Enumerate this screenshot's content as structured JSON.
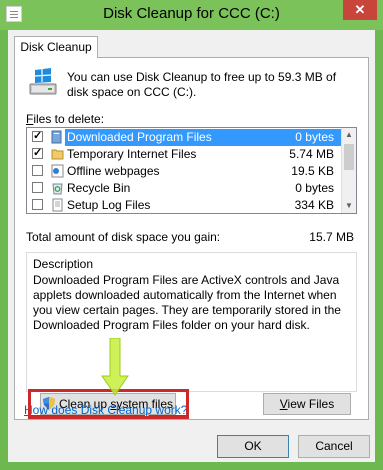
{
  "window": {
    "title": "Disk Cleanup for CCC (C:)",
    "close_glyph": "✕"
  },
  "tab": {
    "label": "Disk Cleanup"
  },
  "intro": {
    "text": "You can use Disk Cleanup to free up to 59.3 MB of disk space on CCC (C:)."
  },
  "files": {
    "label_accel": "F",
    "label_rest": "iles to delete:",
    "items": [
      {
        "checked": true,
        "name": "Downloaded Program Files",
        "size": "0 bytes",
        "icon": "folder-icon",
        "selected": true
      },
      {
        "checked": true,
        "name": "Temporary Internet Files",
        "size": "5.74 MB",
        "icon": "folder-icon"
      },
      {
        "checked": false,
        "name": "Offline webpages",
        "size": "19.5 KB",
        "icon": "webpage-icon"
      },
      {
        "checked": false,
        "name": "Recycle Bin",
        "size": "0 bytes",
        "icon": "recycle-bin-icon"
      },
      {
        "checked": false,
        "name": "Setup Log Files",
        "size": "334 KB",
        "icon": "document-icon"
      }
    ]
  },
  "total": {
    "label": "Total amount of disk space you gain:",
    "value": "15.7 MB"
  },
  "description": {
    "title": "Description",
    "text": "Downloaded Program Files are ActiveX controls and Java applets downloaded automatically from the Internet when you view certain pages. They are temporarily stored in the Downloaded Program Files folder on your hard disk."
  },
  "buttons": {
    "cleanup_pre": "Clean up ",
    "cleanup_accel": "s",
    "cleanup_post": "ystem files",
    "view_accel": "V",
    "view_rest": "iew Files",
    "ok": "OK",
    "cancel": "Cancel"
  },
  "link": {
    "howto": "How does Disk Cleanup work?"
  },
  "colors": {
    "frame": "#6db84f",
    "selection": "#3399ff",
    "highlight_box": "#cc2a2a",
    "arrow": "#c6ef3a",
    "link": "#0066cc"
  }
}
